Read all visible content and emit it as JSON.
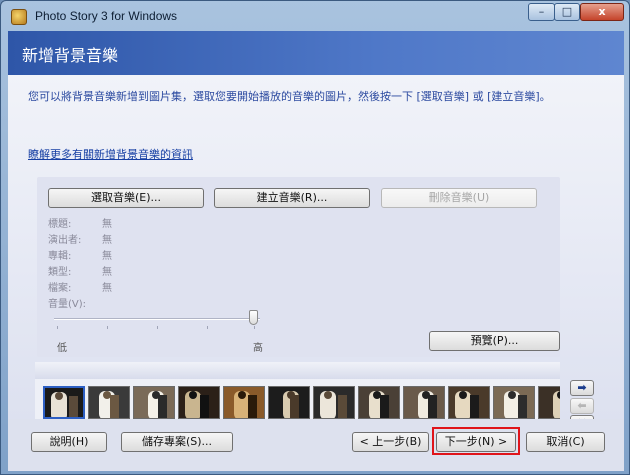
{
  "window": {
    "title": "Photo Story 3 for Windows",
    "min_glyph": "–",
    "max_glyph": "□",
    "close_glyph": "x"
  },
  "header": {
    "title": "新增背景音樂"
  },
  "instructions": "您可以將背景音樂新增到圖片集，選取您要開始播放的音樂的圖片，然後按一下 [選取音樂] 或 [建立音樂]。",
  "learn_link": "瞭解更多有關新增背景音樂的資訊",
  "music": {
    "select_button": "選取音樂(E)...",
    "create_button": "建立音樂(R)...",
    "delete_button": "刪除音樂(U)",
    "fields": [
      {
        "label": "標題:",
        "value": "無"
      },
      {
        "label": "演出者:",
        "value": "無"
      },
      {
        "label": "專輯:",
        "value": "無"
      },
      {
        "label": "類型:",
        "value": "無"
      },
      {
        "label": "檔案:",
        "value": "無"
      }
    ],
    "volume_label": "音量(V):",
    "volume_low": "低",
    "volume_high": "高",
    "volume_level": 1.0,
    "preview_button": "預覽(P)..."
  },
  "filmstrip": {
    "thumbnail_count": 12,
    "selected_index": 0,
    "scroll_thumb_glyph": "|||"
  },
  "side_buttons": {
    "move_right": "➡",
    "move_left": "⬅",
    "remove": "✕"
  },
  "footer": {
    "help_button": "說明(H)",
    "save_button": "儲存專案(S)...",
    "back_button": "< 上一步(B)",
    "next_button": "下一步(N) >",
    "cancel_button": "取消(C)"
  },
  "colors": {
    "header_blue": "#2e56a8",
    "highlight_red": "#e0151b",
    "link_blue": "#163fa3"
  }
}
